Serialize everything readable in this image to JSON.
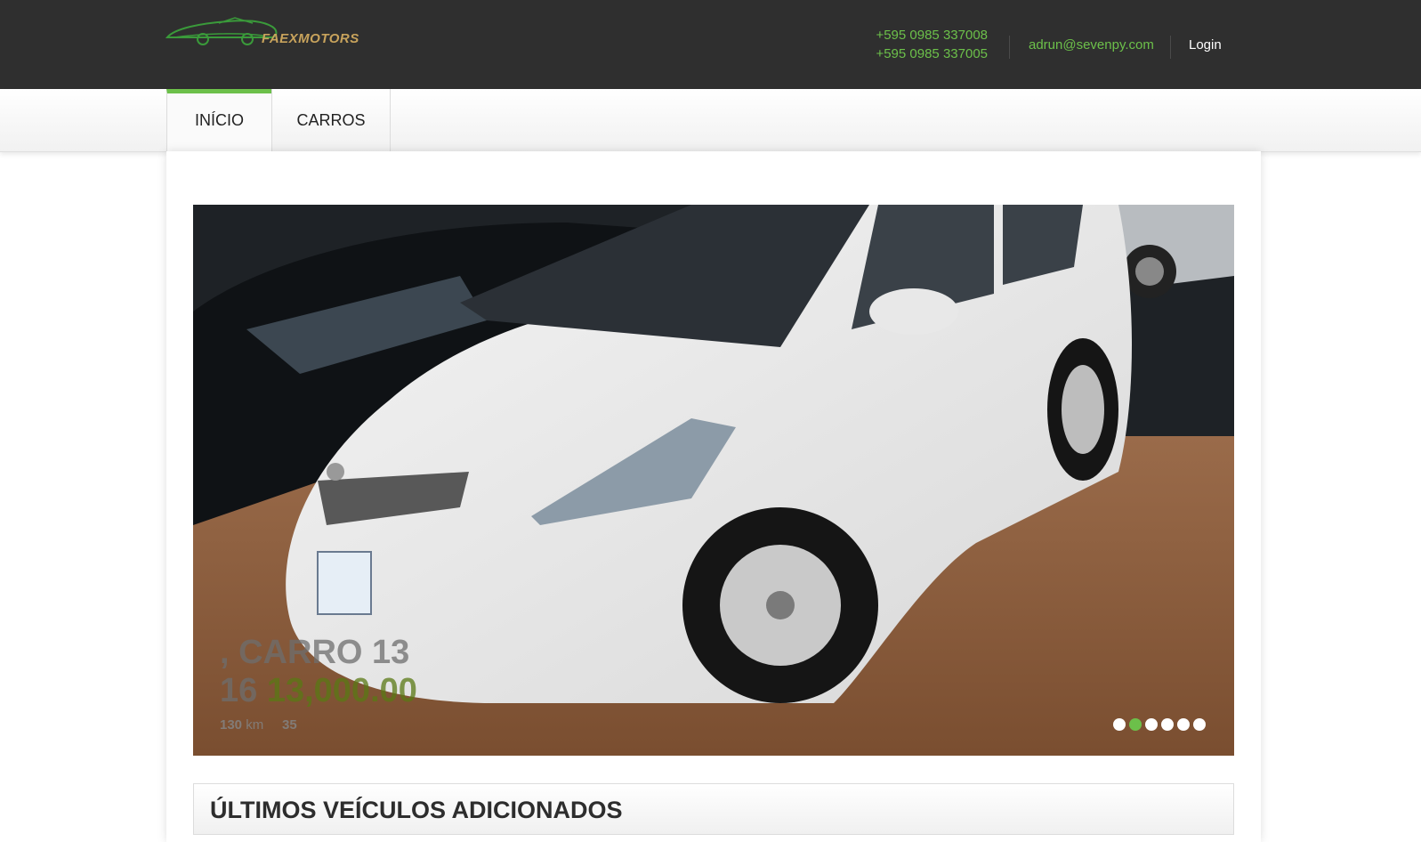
{
  "header": {
    "brand": "FAEXMOTORS",
    "phones": [
      "+595 0985 337008",
      "+595 0985 337005"
    ],
    "email": "adrun@sevenpy.com",
    "login_label": "Login"
  },
  "nav": {
    "tabs": [
      {
        "label": "INÍCIO",
        "active": true
      },
      {
        "label": "CARROS",
        "active": false
      }
    ]
  },
  "slider": {
    "caption_title": ", CARRO 13",
    "caption_year": "16",
    "caption_price": "13,000.00",
    "caption_km_value": "130",
    "caption_km_unit": "km",
    "caption_extra": "35",
    "slide_count": 6,
    "active_slide": 2
  },
  "section": {
    "title": "ÚLTIMOS VEÍCULOS ADICIONADOS"
  },
  "colors": {
    "accent": "#6cc04a",
    "topbar": "#2f2f2f"
  }
}
